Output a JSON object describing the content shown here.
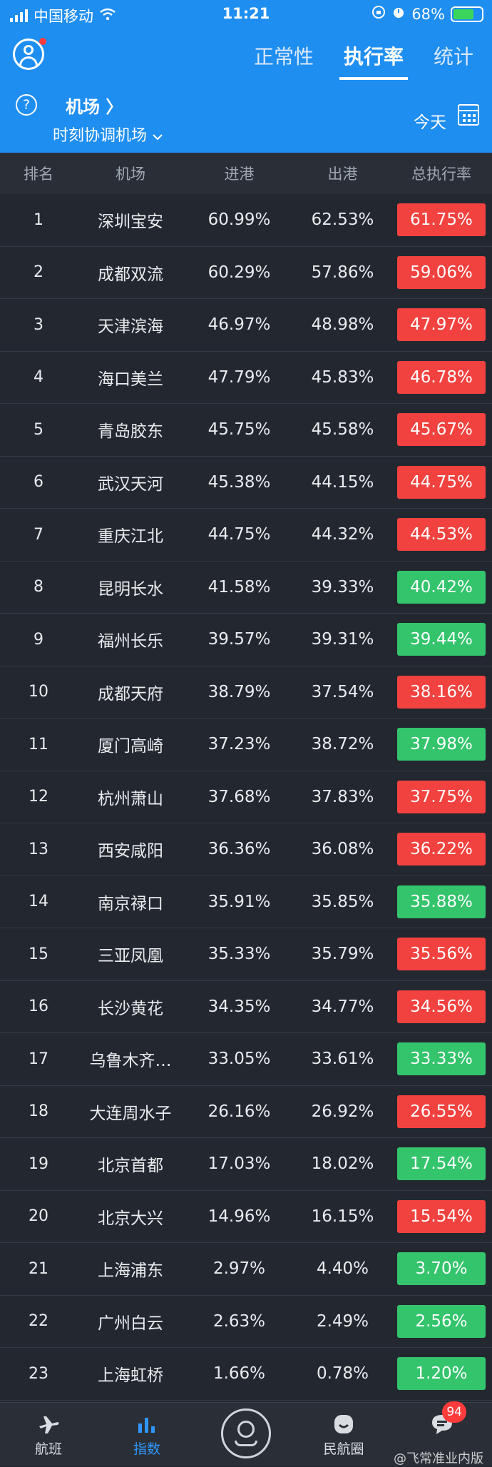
{
  "statusbar": {
    "carrier": "中国移动",
    "time": "11:21",
    "battery": "68%"
  },
  "header": {
    "tabs": [
      {
        "label": "正常性",
        "active": false
      },
      {
        "label": "执行率",
        "active": true
      },
      {
        "label": "统计",
        "active": false
      }
    ]
  },
  "subheader": {
    "help": "?",
    "airport_link": "机场 〉",
    "airport_type": "时刻协调机场",
    "date_label": "今天"
  },
  "table": {
    "columns": [
      "排名",
      "机场",
      "进港",
      "出港",
      "总执行率"
    ],
    "rows": [
      {
        "rank": "1",
        "airport": "深圳宝安",
        "in": "60.99%",
        "out": "62.53%",
        "total": "61.75%",
        "status": "red"
      },
      {
        "rank": "2",
        "airport": "成都双流",
        "in": "60.29%",
        "out": "57.86%",
        "total": "59.06%",
        "status": "red"
      },
      {
        "rank": "3",
        "airport": "天津滨海",
        "in": "46.97%",
        "out": "48.98%",
        "total": "47.97%",
        "status": "red"
      },
      {
        "rank": "4",
        "airport": "海口美兰",
        "in": "47.79%",
        "out": "45.83%",
        "total": "46.78%",
        "status": "red"
      },
      {
        "rank": "5",
        "airport": "青岛胶东",
        "in": "45.75%",
        "out": "45.58%",
        "total": "45.67%",
        "status": "red"
      },
      {
        "rank": "6",
        "airport": "武汉天河",
        "in": "45.38%",
        "out": "44.15%",
        "total": "44.75%",
        "status": "red"
      },
      {
        "rank": "7",
        "airport": "重庆江北",
        "in": "44.75%",
        "out": "44.32%",
        "total": "44.53%",
        "status": "red"
      },
      {
        "rank": "8",
        "airport": "昆明长水",
        "in": "41.58%",
        "out": "39.33%",
        "total": "40.42%",
        "status": "green"
      },
      {
        "rank": "9",
        "airport": "福州长乐",
        "in": "39.57%",
        "out": "39.31%",
        "total": "39.44%",
        "status": "green"
      },
      {
        "rank": "10",
        "airport": "成都天府",
        "in": "38.79%",
        "out": "37.54%",
        "total": "38.16%",
        "status": "red"
      },
      {
        "rank": "11",
        "airport": "厦门高崎",
        "in": "37.23%",
        "out": "38.72%",
        "total": "37.98%",
        "status": "green"
      },
      {
        "rank": "12",
        "airport": "杭州萧山",
        "in": "37.68%",
        "out": "37.83%",
        "total": "37.75%",
        "status": "red"
      },
      {
        "rank": "13",
        "airport": "西安咸阳",
        "in": "36.36%",
        "out": "36.08%",
        "total": "36.22%",
        "status": "red"
      },
      {
        "rank": "14",
        "airport": "南京禄口",
        "in": "35.91%",
        "out": "35.85%",
        "total": "35.88%",
        "status": "green"
      },
      {
        "rank": "15",
        "airport": "三亚凤凰",
        "in": "35.33%",
        "out": "35.79%",
        "total": "35.56%",
        "status": "red"
      },
      {
        "rank": "16",
        "airport": "长沙黄花",
        "in": "34.35%",
        "out": "34.77%",
        "total": "34.56%",
        "status": "red"
      },
      {
        "rank": "17",
        "airport": "乌鲁木齐…",
        "in": "33.05%",
        "out": "33.61%",
        "total": "33.33%",
        "status": "green"
      },
      {
        "rank": "18",
        "airport": "大连周水子",
        "in": "26.16%",
        "out": "26.92%",
        "total": "26.55%",
        "status": "red"
      },
      {
        "rank": "19",
        "airport": "北京首都",
        "in": "17.03%",
        "out": "18.02%",
        "total": "17.54%",
        "status": "green"
      },
      {
        "rank": "20",
        "airport": "北京大兴",
        "in": "14.96%",
        "out": "16.15%",
        "total": "15.54%",
        "status": "red"
      },
      {
        "rank": "21",
        "airport": "上海浦东",
        "in": "2.97%",
        "out": "4.40%",
        "total": "3.70%",
        "status": "green"
      },
      {
        "rank": "22",
        "airport": "广州白云",
        "in": "2.63%",
        "out": "2.49%",
        "total": "2.56%",
        "status": "green"
      },
      {
        "rank": "23",
        "airport": "上海虹桥",
        "in": "1.66%",
        "out": "0.78%",
        "total": "1.20%",
        "status": "green"
      }
    ]
  },
  "bottomnav": {
    "items": [
      {
        "label": "航班",
        "icon": "plane-icon",
        "active": false
      },
      {
        "label": "指数",
        "icon": "bar-chart-icon",
        "active": true
      },
      {
        "label": "",
        "icon": "location-pin-icon",
        "active": false
      },
      {
        "label": "民航圈",
        "icon": "smile-icon",
        "active": false
      },
      {
        "label": "",
        "icon": "message-icon",
        "active": false
      }
    ],
    "message_badge": "94"
  },
  "watermark": "@飞常准业内版",
  "colors": {
    "brand": "#1f8ef1",
    "red": "#f1423f",
    "green": "#33c46c",
    "bg": "#232830"
  }
}
